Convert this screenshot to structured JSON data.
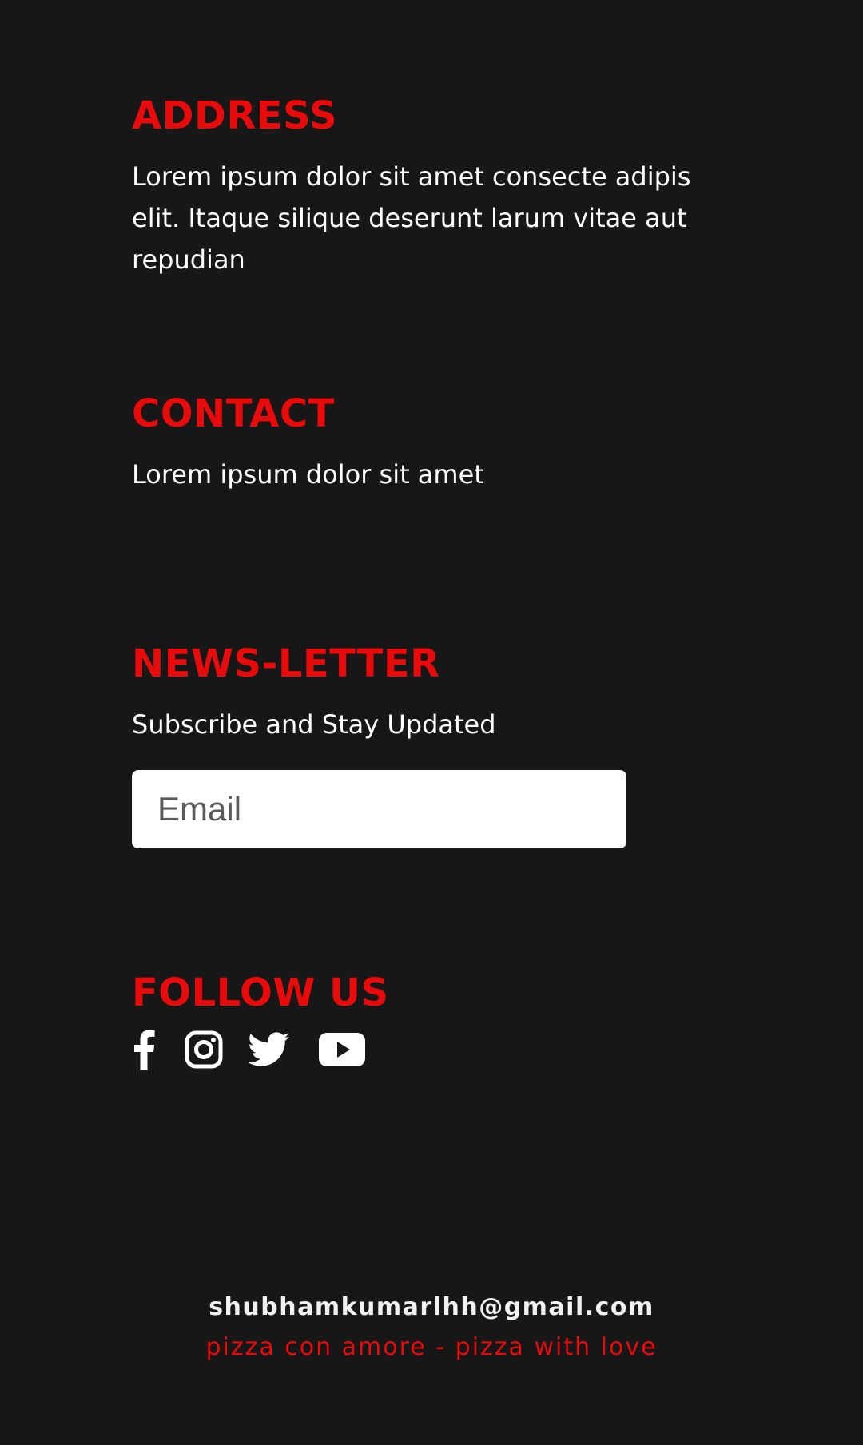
{
  "colors": {
    "background": "#171717",
    "heading": "#e80b0b",
    "text": "#ffffff",
    "tagline": "#e80b0b"
  },
  "address": {
    "heading": "ADDRESS",
    "text": "Lorem ipsum dolor sit amet consecte adipis elit. Itaque silique deserunt larum vitae aut repudian"
  },
  "contact": {
    "heading": "CONTACT",
    "text": "Lorem ipsum dolor sit amet"
  },
  "newsletter": {
    "heading": "NEWS-LETTER",
    "text": "Subscribe and Stay Updated",
    "email_placeholder": "Email",
    "email_value": ""
  },
  "follow": {
    "heading": "FOLLOW US",
    "icons": [
      "facebook-icon",
      "instagram-icon",
      "twitter-icon",
      "youtube-icon"
    ]
  },
  "footer": {
    "email": "shubhamkumarlhh@gmail.com",
    "tagline": "pizza con amore - pizza with love"
  }
}
